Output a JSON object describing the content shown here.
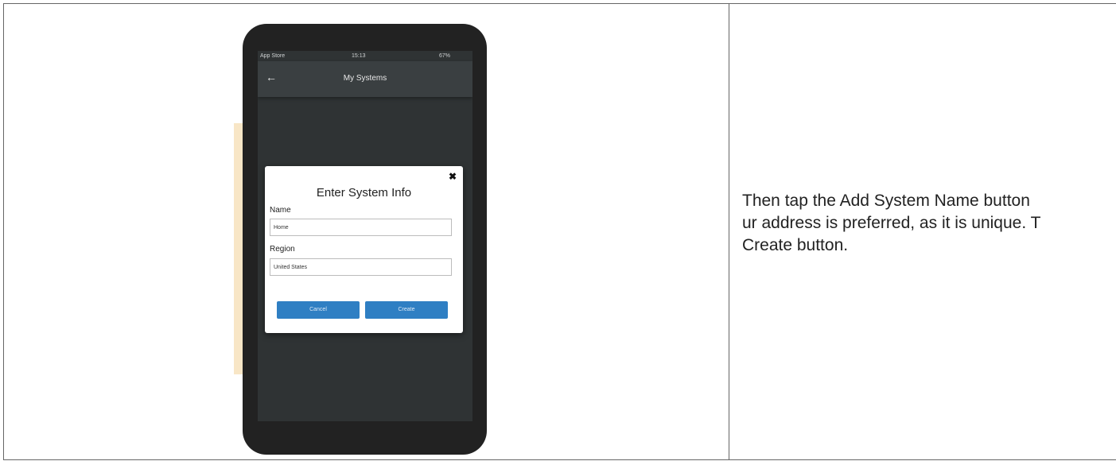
{
  "phone": {
    "status_bar": {
      "carrier": "App Store",
      "time": "15:13",
      "battery": "67%"
    },
    "app_bar": {
      "back_icon": "back-arrow-icon",
      "title": "My Systems"
    },
    "dialog": {
      "close_icon": "close-icon",
      "title": "Enter System Info",
      "name_label": "Name",
      "name_value": "Home",
      "region_label": "Region",
      "region_value": "United States",
      "cancel_label": "Cancel",
      "create_label": "Create"
    }
  },
  "instructions": {
    "line1": "Then tap the Add System Name button",
    "line2": "ur address is preferred, as it is unique. T",
    "line3": "Create button."
  }
}
